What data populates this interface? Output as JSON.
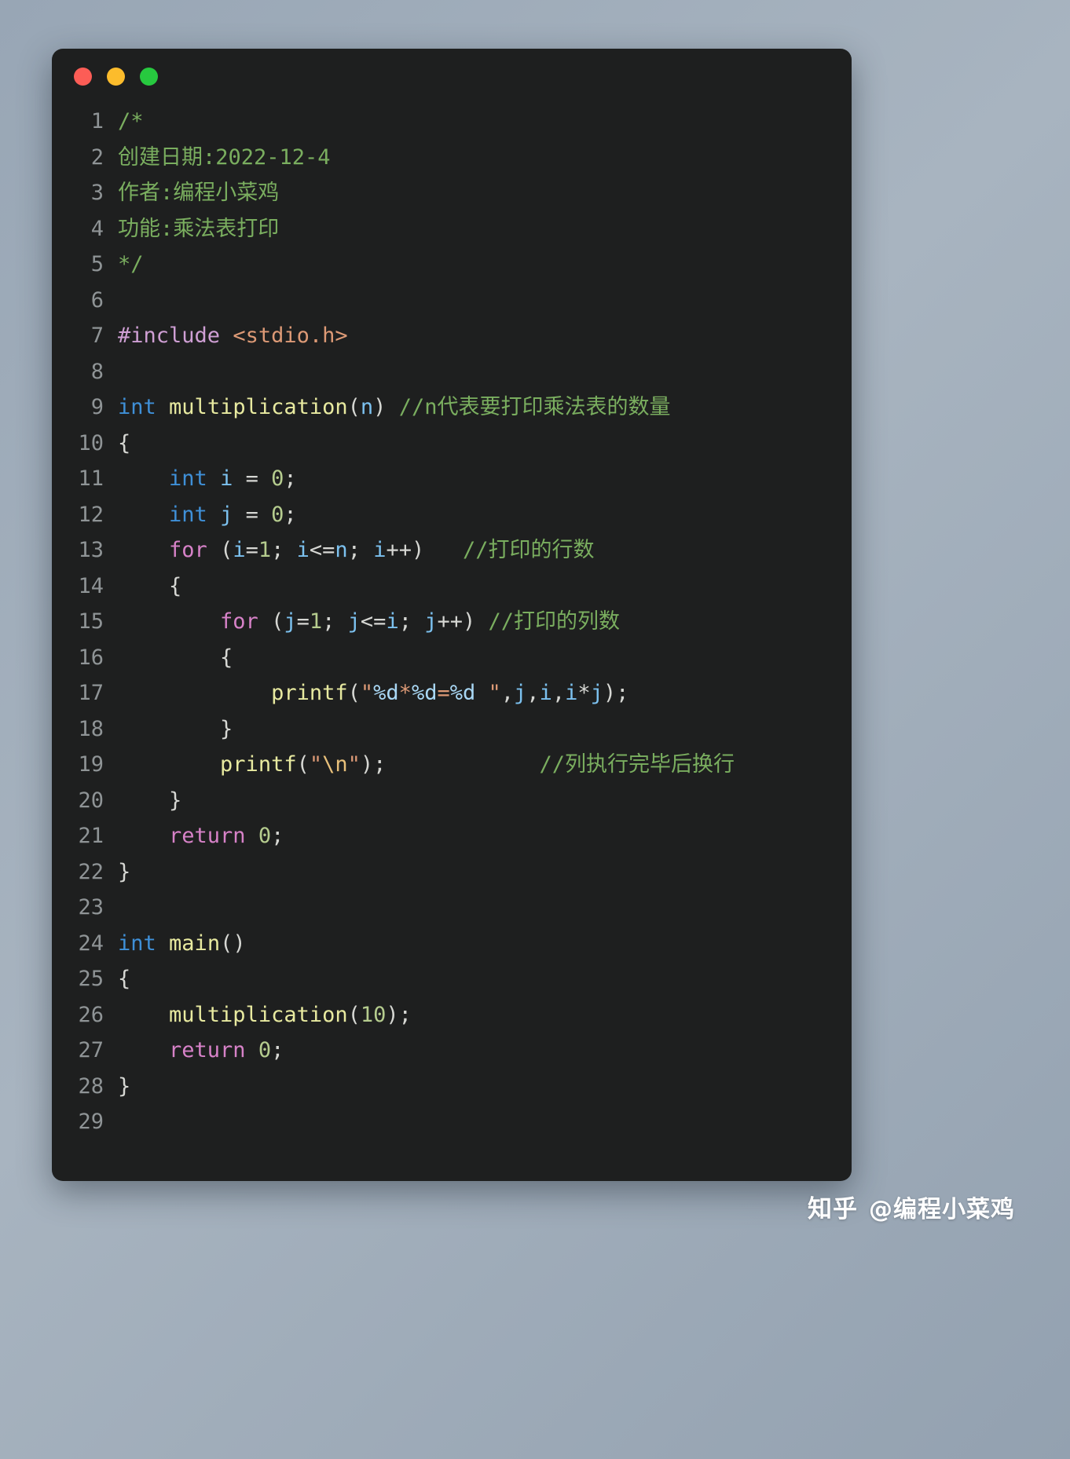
{
  "window": {
    "controls": [
      {
        "name": "close",
        "color": "#fc5d56"
      },
      {
        "name": "minimize",
        "color": "#fcbc2c"
      },
      {
        "name": "maximize",
        "color": "#27c93f"
      }
    ]
  },
  "editor": {
    "language": "c",
    "background": "#1e1f1f",
    "line_number_color": "#8f9496",
    "total_lines": 29,
    "lines": [
      {
        "n": "1",
        "tokens": [
          {
            "t": "/*",
            "c": "t-comment2"
          }
        ]
      },
      {
        "n": "2",
        "tokens": [
          {
            "t": "创建日期:2022-12-4",
            "c": "t-comment2"
          }
        ]
      },
      {
        "n": "3",
        "tokens": [
          {
            "t": "作者:编程小菜鸡",
            "c": "t-comment2"
          }
        ]
      },
      {
        "n": "4",
        "tokens": [
          {
            "t": "功能:乘法表打印",
            "c": "t-comment2"
          }
        ]
      },
      {
        "n": "5",
        "tokens": [
          {
            "t": "*/",
            "c": "t-comment2"
          }
        ]
      },
      {
        "n": "6",
        "tokens": []
      },
      {
        "n": "7",
        "tokens": [
          {
            "t": "#include",
            "c": "t-pre"
          },
          {
            "t": " ",
            "c": "t-plain"
          },
          {
            "t": "<stdio.h>",
            "c": "t-inc"
          }
        ]
      },
      {
        "n": "8",
        "tokens": []
      },
      {
        "n": "9",
        "tokens": [
          {
            "t": "int",
            "c": "t-kw"
          },
          {
            "t": " ",
            "c": "t-plain"
          },
          {
            "t": "multiplication",
            "c": "t-fn"
          },
          {
            "t": "(",
            "c": "t-plain"
          },
          {
            "t": "n",
            "c": "t-var"
          },
          {
            "t": ")",
            "c": "t-plain"
          },
          {
            "t": " ",
            "c": "t-plain"
          },
          {
            "t": "//n代表要打印乘法表的数量",
            "c": "t-comment2"
          }
        ]
      },
      {
        "n": "10",
        "tokens": [
          {
            "t": "{",
            "c": "t-plain"
          }
        ]
      },
      {
        "n": "11",
        "tokens": [
          {
            "t": "    ",
            "c": "t-plain"
          },
          {
            "t": "int",
            "c": "t-kw"
          },
          {
            "t": " ",
            "c": "t-plain"
          },
          {
            "t": "i",
            "c": "t-var"
          },
          {
            "t": " = ",
            "c": "t-plain"
          },
          {
            "t": "0",
            "c": "t-num"
          },
          {
            "t": ";",
            "c": "t-plain"
          }
        ]
      },
      {
        "n": "12",
        "tokens": [
          {
            "t": "    ",
            "c": "t-plain"
          },
          {
            "t": "int",
            "c": "t-kw"
          },
          {
            "t": " ",
            "c": "t-plain"
          },
          {
            "t": "j",
            "c": "t-var"
          },
          {
            "t": " = ",
            "c": "t-plain"
          },
          {
            "t": "0",
            "c": "t-num"
          },
          {
            "t": ";",
            "c": "t-plain"
          }
        ]
      },
      {
        "n": "13",
        "tokens": [
          {
            "t": "    ",
            "c": "t-plain"
          },
          {
            "t": "for",
            "c": "t-kw2"
          },
          {
            "t": " (",
            "c": "t-plain"
          },
          {
            "t": "i",
            "c": "t-var"
          },
          {
            "t": "=",
            "c": "t-plain"
          },
          {
            "t": "1",
            "c": "t-num"
          },
          {
            "t": "; ",
            "c": "t-plain"
          },
          {
            "t": "i",
            "c": "t-var"
          },
          {
            "t": "<=",
            "c": "t-plain"
          },
          {
            "t": "n",
            "c": "t-var"
          },
          {
            "t": "; ",
            "c": "t-plain"
          },
          {
            "t": "i",
            "c": "t-var"
          },
          {
            "t": "++)",
            "c": "t-plain"
          },
          {
            "t": "   ",
            "c": "t-plain"
          },
          {
            "t": "//打印的行数",
            "c": "t-comment2"
          }
        ]
      },
      {
        "n": "14",
        "tokens": [
          {
            "t": "    {",
            "c": "t-plain"
          }
        ]
      },
      {
        "n": "15",
        "tokens": [
          {
            "t": "        ",
            "c": "t-plain"
          },
          {
            "t": "for",
            "c": "t-kw2"
          },
          {
            "t": " (",
            "c": "t-plain"
          },
          {
            "t": "j",
            "c": "t-var"
          },
          {
            "t": "=",
            "c": "t-plain"
          },
          {
            "t": "1",
            "c": "t-num"
          },
          {
            "t": "; ",
            "c": "t-plain"
          },
          {
            "t": "j",
            "c": "t-var"
          },
          {
            "t": "<=",
            "c": "t-plain"
          },
          {
            "t": "i",
            "c": "t-var"
          },
          {
            "t": "; ",
            "c": "t-plain"
          },
          {
            "t": "j",
            "c": "t-var"
          },
          {
            "t": "++)",
            "c": "t-plain"
          },
          {
            "t": " ",
            "c": "t-plain"
          },
          {
            "t": "//打印的列数",
            "c": "t-comment2"
          }
        ]
      },
      {
        "n": "16",
        "tokens": [
          {
            "t": "        {",
            "c": "t-plain"
          }
        ]
      },
      {
        "n": "17",
        "tokens": [
          {
            "t": "            ",
            "c": "t-plain"
          },
          {
            "t": "printf",
            "c": "t-fn"
          },
          {
            "t": "(",
            "c": "t-plain"
          },
          {
            "t": "\"",
            "c": "t-str"
          },
          {
            "t": "%d",
            "c": "t-fmt"
          },
          {
            "t": "*",
            "c": "t-str"
          },
          {
            "t": "%d",
            "c": "t-fmt"
          },
          {
            "t": "=",
            "c": "t-str"
          },
          {
            "t": "%d",
            "c": "t-fmt"
          },
          {
            "t": " ",
            "c": "t-str"
          },
          {
            "t": "\"",
            "c": "t-str"
          },
          {
            "t": ",",
            "c": "t-plain"
          },
          {
            "t": "j",
            "c": "t-var"
          },
          {
            "t": ",",
            "c": "t-plain"
          },
          {
            "t": "i",
            "c": "t-var"
          },
          {
            "t": ",",
            "c": "t-plain"
          },
          {
            "t": "i",
            "c": "t-var"
          },
          {
            "t": "*",
            "c": "t-plain"
          },
          {
            "t": "j",
            "c": "t-var"
          },
          {
            "t": ");",
            "c": "t-plain"
          }
        ]
      },
      {
        "n": "18",
        "tokens": [
          {
            "t": "        }",
            "c": "t-plain"
          }
        ]
      },
      {
        "n": "19",
        "tokens": [
          {
            "t": "        ",
            "c": "t-plain"
          },
          {
            "t": "printf",
            "c": "t-fn"
          },
          {
            "t": "(",
            "c": "t-plain"
          },
          {
            "t": "\"",
            "c": "t-str"
          },
          {
            "t": "\\n",
            "c": "t-esc"
          },
          {
            "t": "\"",
            "c": "t-str"
          },
          {
            "t": ");",
            "c": "t-plain"
          },
          {
            "t": "            ",
            "c": "t-plain"
          },
          {
            "t": "//列执行完毕后换行",
            "c": "t-comment2"
          }
        ]
      },
      {
        "n": "20",
        "tokens": [
          {
            "t": "    }",
            "c": "t-plain"
          }
        ]
      },
      {
        "n": "21",
        "tokens": [
          {
            "t": "    ",
            "c": "t-plain"
          },
          {
            "t": "return",
            "c": "t-kw2"
          },
          {
            "t": " ",
            "c": "t-plain"
          },
          {
            "t": "0",
            "c": "t-num"
          },
          {
            "t": ";",
            "c": "t-plain"
          }
        ]
      },
      {
        "n": "22",
        "tokens": [
          {
            "t": "}",
            "c": "t-plain"
          }
        ]
      },
      {
        "n": "23",
        "tokens": []
      },
      {
        "n": "24",
        "tokens": [
          {
            "t": "int",
            "c": "t-kw"
          },
          {
            "t": " ",
            "c": "t-plain"
          },
          {
            "t": "main",
            "c": "t-fn"
          },
          {
            "t": "()",
            "c": "t-plain"
          }
        ]
      },
      {
        "n": "25",
        "tokens": [
          {
            "t": "{",
            "c": "t-plain"
          }
        ]
      },
      {
        "n": "26",
        "tokens": [
          {
            "t": "    ",
            "c": "t-plain"
          },
          {
            "t": "multiplication",
            "c": "t-fn"
          },
          {
            "t": "(",
            "c": "t-plain"
          },
          {
            "t": "10",
            "c": "t-num"
          },
          {
            "t": ");",
            "c": "t-plain"
          }
        ]
      },
      {
        "n": "27",
        "tokens": [
          {
            "t": "    ",
            "c": "t-plain"
          },
          {
            "t": "return",
            "c": "t-kw2"
          },
          {
            "t": " ",
            "c": "t-plain"
          },
          {
            "t": "0",
            "c": "t-num"
          },
          {
            "t": ";",
            "c": "t-plain"
          }
        ]
      },
      {
        "n": "28",
        "tokens": [
          {
            "t": "}",
            "c": "t-plain"
          }
        ]
      },
      {
        "n": "29",
        "tokens": []
      }
    ]
  },
  "watermark": {
    "logo": "知乎",
    "handle": "@编程小菜鸡"
  }
}
